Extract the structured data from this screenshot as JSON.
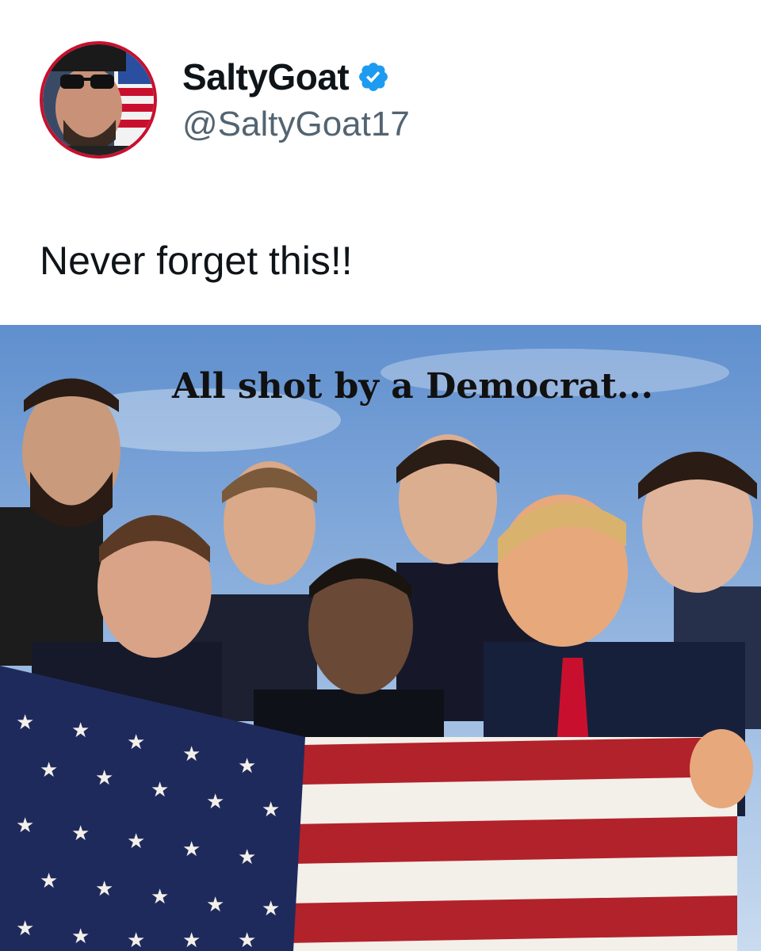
{
  "post": {
    "display_name": "SaltyGoat",
    "handle": "@SaltyGoat17",
    "verified": true,
    "text": "Never forget this!!"
  },
  "media": {
    "caption": "All shot by a Democrat..."
  },
  "colors": {
    "verified_badge": "#1d9bf0",
    "avatar_ring": "#c8102e",
    "handle_text": "#536471",
    "sky": "#7aa3d6",
    "flag_red": "#b2222a",
    "flag_blue": "#1f2a5c"
  },
  "icons": [
    "verified-badge-icon"
  ]
}
